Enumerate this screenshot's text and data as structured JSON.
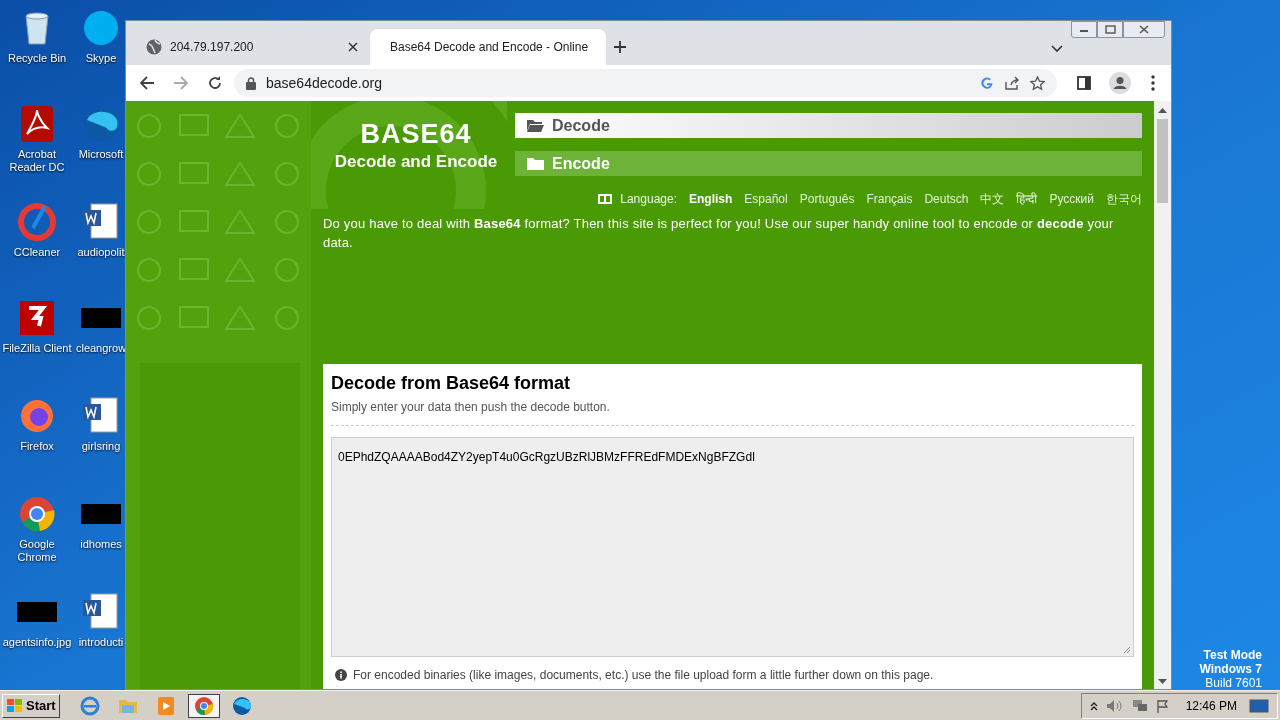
{
  "desktop": {
    "icon_columns": [
      {
        "icons": [
          {
            "label": "Recycle Bin",
            "kind": "recycle"
          },
          {
            "label": "Acrobat Reader DC",
            "kind": "acrobat"
          },
          {
            "label": "CCleaner",
            "kind": "ccleaner"
          },
          {
            "label": "FileZilla Client",
            "kind": "filezilla"
          },
          {
            "label": "Firefox",
            "kind": "firefox"
          },
          {
            "label": "Google Chrome",
            "kind": "chrome"
          },
          {
            "label": "agentsinfo.jpg",
            "kind": "redacted"
          }
        ]
      },
      {
        "icons": [
          {
            "label": "Skype",
            "kind": "skype"
          },
          {
            "label": "Microsoft",
            "kind": "edge"
          },
          {
            "label": "audiopolit",
            "kind": "word"
          },
          {
            "label": "cleangrow",
            "kind": "redacted"
          },
          {
            "label": "girlsring",
            "kind": "word"
          },
          {
            "label": "idhomes",
            "kind": "redacted"
          },
          {
            "label": "introducti",
            "kind": "word"
          }
        ]
      }
    ],
    "test_mode": [
      "Test Mode",
      "Windows 7",
      "Build 7601"
    ]
  },
  "browser": {
    "tabs": [
      {
        "title": "204.79.197.200",
        "kind": "globe",
        "selected": false
      },
      {
        "title": "Base64 Decode and Encode - Online",
        "kind": "site",
        "selected": true
      }
    ],
    "address": "base64decode.org",
    "page": {
      "logo_title": "BASE64",
      "logo_subtitle": "Decode and Encode",
      "nav": [
        {
          "label": "Decode",
          "selected": true
        },
        {
          "label": "Encode",
          "selected": false
        }
      ],
      "language_label": "Language:",
      "languages": [
        {
          "label": "English",
          "selected": true
        },
        {
          "label": "Español",
          "selected": false
        },
        {
          "label": "Português",
          "selected": false
        },
        {
          "label": "Français",
          "selected": false
        },
        {
          "label": "Deutsch",
          "selected": false
        },
        {
          "label": "中文",
          "selected": false
        },
        {
          "label": "हिन्दी",
          "selected": false
        },
        {
          "label": "Русский",
          "selected": false
        },
        {
          "label": "한국어",
          "selected": false
        }
      ],
      "intro": "Do you have to deal with **Base64** format? Then this site is perfect for you! Use our super handy online tool to encode or **decode** your data.",
      "card": {
        "title": "Decode from Base64 format",
        "subtitle": "Simply enter your data then push the decode button.",
        "input_value": "0EPhdZQAAAABod4ZY2yepT4u0GcRgzUBzRlJBMzFFREdFMDExNgBFZGdl",
        "note": "For encoded binaries (like images, documents, etc.) use the file upload form a little further down on this page."
      }
    }
  },
  "taskbar": {
    "start": "Start",
    "apps": [
      {
        "kind": "ie",
        "selected": false
      },
      {
        "kind": "explorer",
        "selected": false
      },
      {
        "kind": "media",
        "selected": false
      },
      {
        "kind": "chrome",
        "selected": true
      },
      {
        "kind": "edge",
        "selected": false
      }
    ],
    "clock": "12:46 PM"
  }
}
